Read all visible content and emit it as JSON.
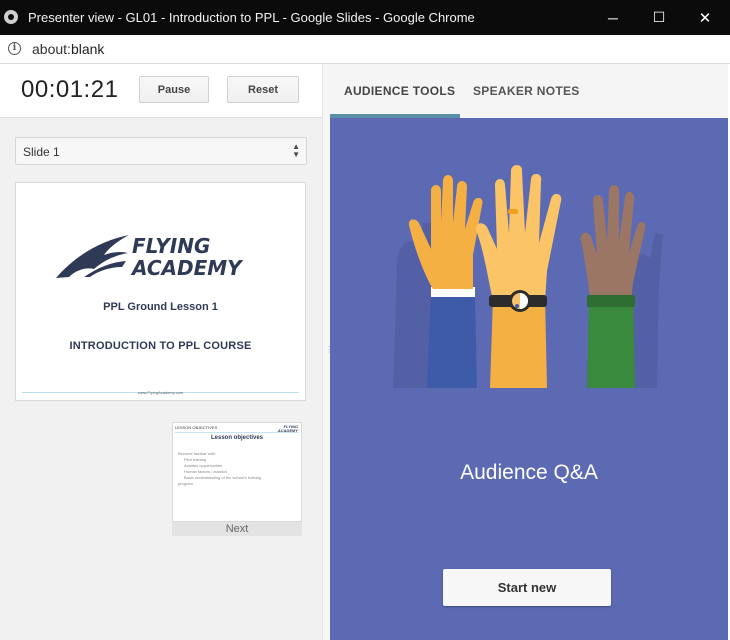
{
  "window": {
    "title": "Presenter view - GL01 - Introduction to PPL - Google Slides - Google Chrome",
    "minimize_glyph": "─",
    "maximize_glyph": "☐",
    "close_glyph": "✕"
  },
  "address_bar": {
    "url_scheme": "about:",
    "url_host": "blank"
  },
  "timer": {
    "value": "00:01:21",
    "pause_label": "Pause",
    "reset_label": "Reset"
  },
  "slide_selector": {
    "selected": "Slide 1"
  },
  "current_slide": {
    "logo_line1": "FLYING",
    "logo_line2": "ACADEMY",
    "lesson": "PPL Ground Lesson 1",
    "course": "INTRODUCTION TO PPL COURSE",
    "footer_url": "www.FlyingAcademy.com"
  },
  "next_slide": {
    "header": "LESSON OBJECTIVES",
    "logo": "FLYING ACADEMY",
    "title": "Lesson objectives",
    "lines": [
      "Become familiar with:",
      "Pilot training",
      "Aviation opportunities",
      "Human factors / aviation",
      "Basic understanding of the school's training",
      "program"
    ],
    "label": "Next"
  },
  "tabs": [
    {
      "label": "AUDIENCE TOOLS",
      "active": true
    },
    {
      "label": "SPEAKER NOTES",
      "active": false
    }
  ],
  "audience": {
    "title": "Audience Q&A",
    "start_label": "Start new"
  },
  "colors": {
    "panel_bg": "#5c6ab3",
    "tab_accent": "#5b8fa8",
    "logo_navy": "#2f3a57"
  }
}
